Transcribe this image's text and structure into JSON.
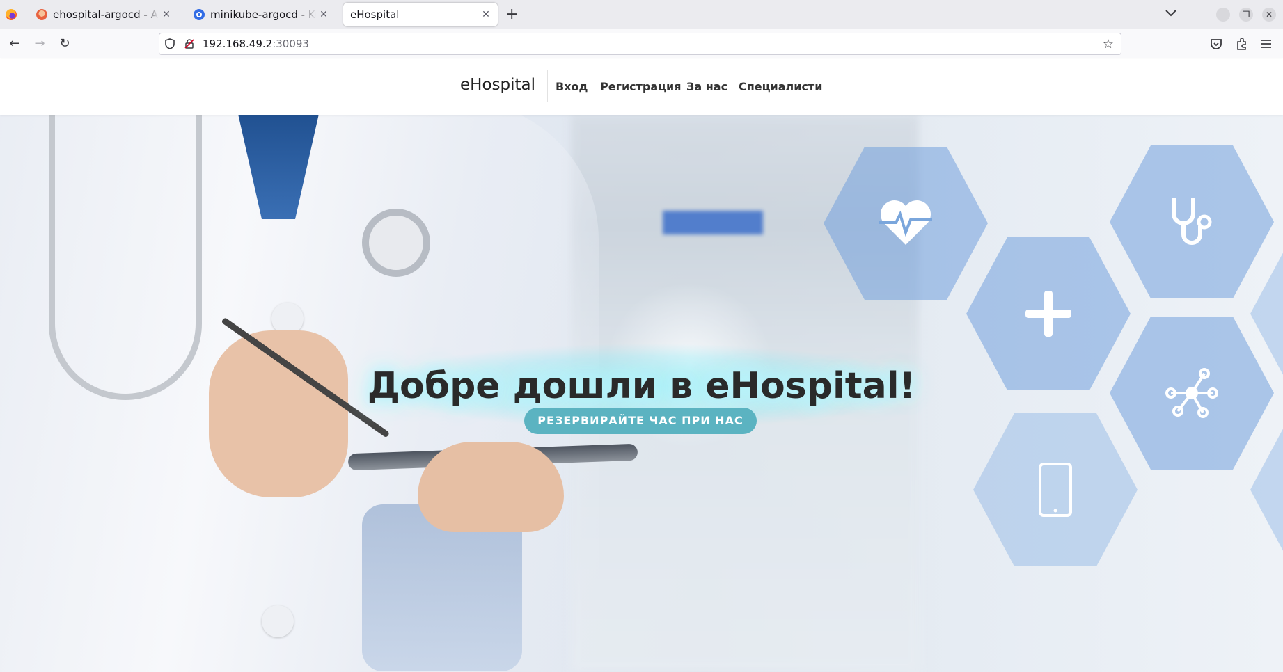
{
  "browser": {
    "tabs": [
      {
        "label": "ehospital-argocd - Applic",
        "favicon": "argo-icon",
        "active": false
      },
      {
        "label": "minikube-argocd - Kuber",
        "favicon": "kubernetes-icon",
        "active": false
      },
      {
        "label": "eHospital",
        "favicon": "",
        "active": true
      }
    ],
    "url_host": "192.168.49.2",
    "url_port": ":30093"
  },
  "site": {
    "brand": "eHospital",
    "nav": [
      {
        "label": "Вход"
      },
      {
        "label": "Регистрация"
      },
      {
        "label": "За нас"
      },
      {
        "label": "Специалисти"
      }
    ]
  },
  "hero": {
    "title": "Добре дошли в eHospital!",
    "cta_label": "РЕЗЕРВИРАЙТЕ ЧАС ПРИ НАС",
    "icons": [
      "heartbeat-icon",
      "stethoscope-icon",
      "plus-icon",
      "network-icon",
      "smartphone-icon"
    ]
  },
  "colors": {
    "cta": "#5bb3c1",
    "hexagon": "#72a0dc",
    "glow": "#8cebf5"
  }
}
